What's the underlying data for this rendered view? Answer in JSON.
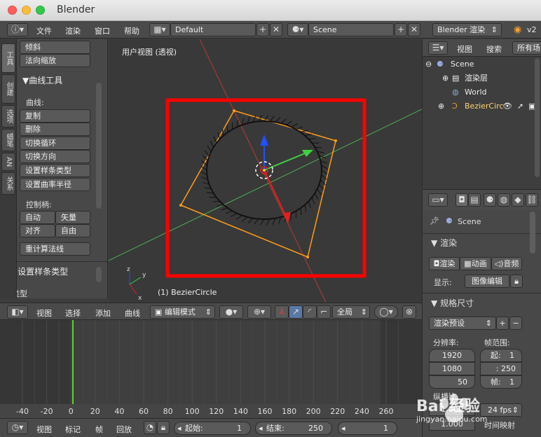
{
  "window": {
    "title": "Blender"
  },
  "topbar": {
    "menus": [
      "文件",
      "渲染",
      "窗口",
      "帮助"
    ],
    "layout": "Default",
    "scene": "Scene",
    "engine": "Blender 渲染",
    "version": "v2"
  },
  "left_tabs": [
    "工具",
    "创建",
    "选项",
    "蜡笔",
    "AN",
    "关系"
  ],
  "tool_panel": {
    "top_buttons": [
      "倾斜",
      "法向缩放"
    ],
    "curve_tools_header": "曲线工具",
    "curve_label": "曲线:",
    "curve_buttons": [
      "复制",
      "删除",
      "切换循环",
      "切换方向",
      "设置样条类型",
      "设置曲率半径"
    ],
    "handles_label": "控制柄:",
    "handle_buttons": [
      "自动",
      "矢量",
      "对齐",
      "自由"
    ],
    "recalc_button": "重计算法线",
    "spline_type_header": "设置样条类型",
    "type_label": "类型"
  },
  "viewport": {
    "view_label": "用户视图 (透视)",
    "object_label": "(1) BezierCircle",
    "axis_y": "y",
    "axis_z": "z",
    "axis_x": "x"
  },
  "viewport_header": {
    "menus": [
      "视图",
      "选择",
      "添加",
      "曲线"
    ],
    "mode": "编辑模式",
    "pivot": "全局"
  },
  "timeline": {
    "ticks": [
      "-40",
      "-20",
      "0",
      "20",
      "40",
      "60",
      "80",
      "100",
      "120",
      "140",
      "160",
      "180",
      "200",
      "220",
      "240",
      "260"
    ],
    "current_frame": 1
  },
  "timeline_bar": {
    "menus": [
      "视图",
      "标记",
      "帧",
      "回放"
    ],
    "start_label": "起始:",
    "start_value": "1",
    "end_label": "结束:",
    "end_value": "250",
    "frame_value": "1"
  },
  "outliner": {
    "view_label": "视图",
    "search_label": "搜索",
    "filter_label": "所有场",
    "items": [
      "Scene",
      "渲染层",
      "World",
      "BezierCirc"
    ]
  },
  "properties": {
    "scene_name": "Scene",
    "render_header": "渲染",
    "render_button": "渲染",
    "anim_button": "动画",
    "audio_button": "音频",
    "display_label": "显示:",
    "display_value": "图像编辑",
    "dimensions_header": "规格尺寸",
    "preset": "渲染预设",
    "resolution_label": "分辨率:",
    "frame_range_label": "帧范围:",
    "res_x": "1920",
    "res_y": "1080",
    "res_pct": "50",
    "start_label": "起:",
    "start_value": "1",
    "end_value": ": 250",
    "step_label": "帧:",
    "step_value": "1",
    "aspect_label": "纵横比",
    "aspect_value": "1.000",
    "fps_value": "24 fps",
    "aspect_value_2": "1.000",
    "time_map_label": "时间映射"
  },
  "watermark": {
    "main": "Bai 经验",
    "url": "jingyan.baidu.com"
  },
  "colors": {
    "selection_box": "#ff0000",
    "curve": "#ff9d1a",
    "x_axis": "#c0392b",
    "y_axis": "#4caf50",
    "frame_line": "#5bd23a"
  }
}
